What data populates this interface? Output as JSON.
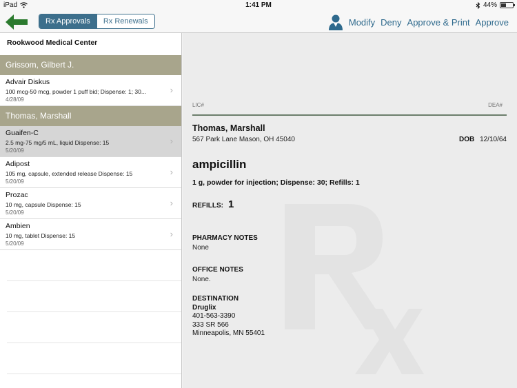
{
  "status_bar": {
    "device": "iPad",
    "time": "1:41 PM",
    "battery": "44%",
    "battery_level": 0.44
  },
  "nav": {
    "tabs": [
      {
        "label": "Rx Approvals",
        "active": true
      },
      {
        "label": "Rx Renewals",
        "active": false
      }
    ],
    "actions": {
      "modify": "Modify",
      "deny": "Deny",
      "approve_print": "Approve & Print",
      "approve": "Approve"
    },
    "accent_color": "#3d6f8c"
  },
  "list": {
    "facility": "Rookwood Medical Center",
    "groups": [
      {
        "patient": "Grissom, Gilbert J.",
        "items": [
          {
            "name": "Advair Diskus",
            "desc": "100 mcg-50 mcg, powder 1 puff bid; Dispense: 1; 30...",
            "date": "4/28/09"
          }
        ]
      },
      {
        "patient": "Thomas, Marshall",
        "items": [
          {
            "name": "Guaifen-C",
            "desc": "2.5 mg-75 mg/5 mL, liquid Dispense: 15",
            "date": "5/20/09",
            "selected": true
          },
          {
            "name": "Adipost",
            "desc": "105 mg, capsule, extended release Dispense: 15",
            "date": "5/20/09"
          },
          {
            "name": "Prozac",
            "desc": "10 mg, capsule Dispense: 15",
            "date": "5/20/09"
          },
          {
            "name": "Ambien",
            "desc": "10 mg, tablet Dispense: 15",
            "date": "5/20/09"
          }
        ]
      }
    ]
  },
  "detail": {
    "lic_label": "LIC#",
    "dea_label": "DEA#",
    "patient_name": "Thomas, Marshall",
    "address": "567 Park Lane Mason, OH 45040",
    "dob_label": "DOB",
    "dob": "12/10/64",
    "drug": "ampicillin",
    "drug_desc": "1 g, powder for injection; Dispense: 30; Refills: 1",
    "refills_label": "REFILLS:",
    "refills": "1",
    "pharmacy_notes_label": "PHARMACY NOTES",
    "pharmacy_notes": "None",
    "office_notes_label": "OFFICE NOTES",
    "office_notes": "None.",
    "destination_label": "DESTINATION",
    "destination": {
      "name": "Druglix",
      "phone": "401-563-3390",
      "street": "333 SR 566",
      "city": "Minneapolis, MN 55401"
    }
  }
}
